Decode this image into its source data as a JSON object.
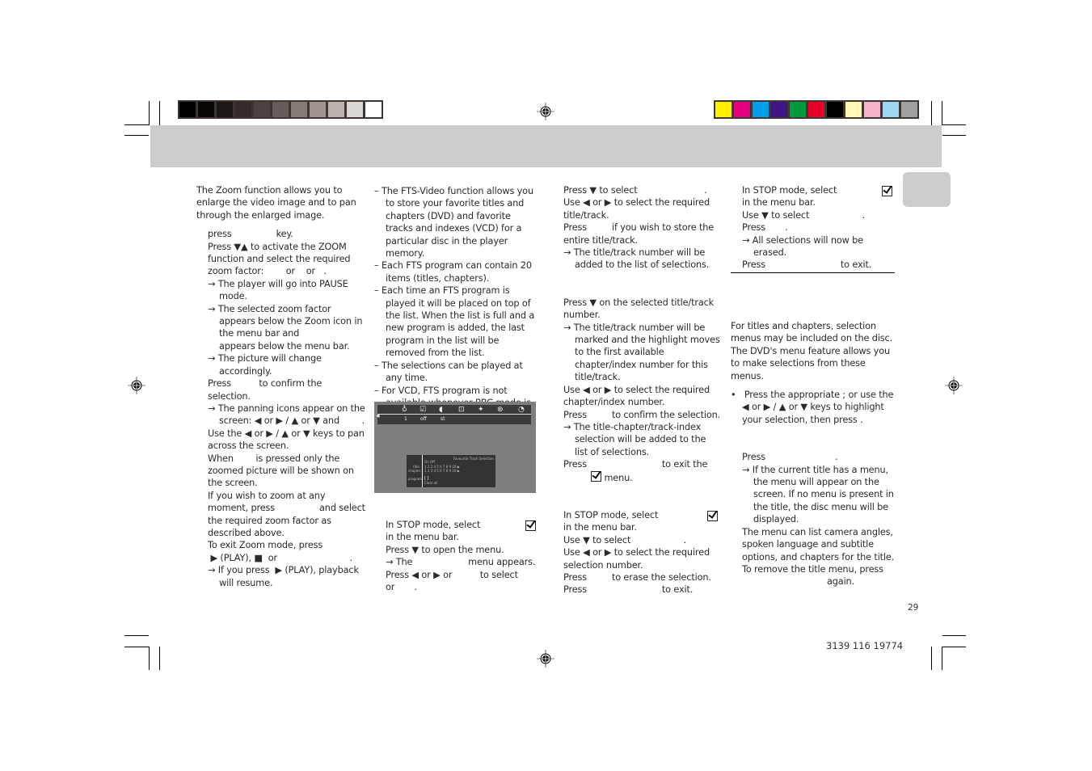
{
  "colorbars": {
    "grayscale": [
      "#000000",
      "#090606",
      "#1e1815",
      "#342a27",
      "#4b4340",
      "#655d59",
      "#857a76",
      "#a09590",
      "#bdb3ae",
      "#ddd7d3",
      "#ffffff"
    ],
    "process": [
      "#fff100",
      "#e4007f",
      "#00a0e9",
      "#3e1582",
      "#009a3e",
      "#e60026",
      "#000000",
      "#fff9b1",
      "#f7b3cb",
      "#9fd6f4",
      "#a0a0a0"
    ]
  },
  "col1": {
    "intro": "The Zoom function allows you to enlarge the video image and to pan through the enlarged image.",
    "lines": [
      {
        "type": "ind",
        "text": "press                key."
      },
      {
        "type": "ind",
        "text": "Press ▼▲ to activate the ZOOM function and select the required zoom factor:        or    or   ."
      },
      {
        "type": "arr",
        "text": "→ The player will go into PAUSE mode."
      },
      {
        "type": "arr",
        "text": "→ The selected zoom factor appears below the Zoom icon in the menu bar and"
      },
      {
        "type": "cont",
        "text": "appears below the menu bar."
      },
      {
        "type": "arr",
        "text": "→ The picture will change accordingly."
      },
      {
        "type": "ind",
        "text": "Press          to confirm the selection."
      },
      {
        "type": "arr",
        "text": "→ The panning icons appear on the screen: ◀ or ▶ / ▲ or ▼ and        ."
      },
      {
        "type": "ind",
        "text": "Use the ◀ or ▶ / ▲ or ▼ keys to pan across the screen."
      },
      {
        "type": "ind",
        "text": "When        is pressed only the zoomed picture will be shown on the screen."
      },
      {
        "type": "ind",
        "text": "If you wish to zoom at any moment, press                and select the required zoom factor as described above."
      },
      {
        "type": "ind",
        "text": "To exit Zoom mode, press"
      },
      {
        "type": "ind",
        "text": " ▶ (PLAY), ■  or                          ."
      },
      {
        "type": "arr",
        "text": "→ If you press  ▶ (PLAY), playback will resume."
      }
    ]
  },
  "col2": {
    "bullets": [
      "The FTS-Video function allows you to store your favorite titles and chapters (DVD) and favorite tracks and indexes (VCD) for a particular disc in the player memory.",
      "Each FTS program can contain 20 items (titles, chapters).",
      "Each time an FTS program is played it will be placed on top of the list. When the list is full and a new program is added, the last program in the list will be removed from the list.",
      "The selections can be played at any time.",
      "For VCD,  FTS program is not available whenever PBC mode is switched on."
    ],
    "screen": {
      "menu_values": [
        "1",
        "off",
        "st"
      ],
      "fts_title": "Favourite Track Selection",
      "on_off": "On   Off",
      "row_title_label": "title",
      "row_chapter_label": "chapter",
      "row_numbers": "1  2  3  4  5  6  7  8  9  10 ▶",
      "program_label": "program",
      "program_value": "[ ]",
      "clear_all": "Clear all"
    },
    "steps": [
      {
        "type": "plain",
        "text": "In STOP mode, select",
        "check": true
      },
      {
        "type": "plain",
        "text": "in the menu bar."
      },
      {
        "type": "plain",
        "text": "Press ▼ to open the menu."
      },
      {
        "type": "arrow",
        "text": "→ The                    menu appears."
      },
      {
        "type": "plain",
        "text": "Press ◀ or ▶ or          to select"
      },
      {
        "type": "plain",
        "text": "or       ."
      }
    ]
  },
  "col3": {
    "block1": [
      {
        "type": "plain",
        "text": "Press ▼ to select                        ."
      },
      {
        "type": "plain",
        "text": "Use ◀ or ▶ to select the required title/track."
      },
      {
        "type": "plain",
        "text": "Press         if you wish to store the entire title/track."
      },
      {
        "type": "arr",
        "text": "→ The title/track number will be added to the list of selections."
      }
    ],
    "block2": [
      {
        "type": "plain",
        "text": "Press ▼ on the selected title/track number."
      },
      {
        "type": "arr",
        "text": "→ The title/track number will be marked and the highlight moves to the first available chapter/index number for this title/track."
      },
      {
        "type": "plain",
        "text": "Use ◀ or ▶ to select the required chapter/index number."
      },
      {
        "type": "plain",
        "text": "Press         to confirm the selection."
      },
      {
        "type": "arr",
        "text": "→ The title-chapter/track-index selection will be added to the list of selections."
      },
      {
        "type": "plain",
        "text": "Press                           to exit the"
      },
      {
        "type": "menu",
        "text": "menu."
      }
    ],
    "block3": [
      {
        "type": "plain",
        "text": "In STOP mode, select",
        "check": true
      },
      {
        "type": "plain",
        "text": "in the menu bar."
      },
      {
        "type": "plain",
        "text": "Use ▼ to select                   ."
      },
      {
        "type": "plain",
        "text": "Use ◀ or ▶ to select the required selection number."
      },
      {
        "type": "plain",
        "text": "Press         to erase the selection."
      },
      {
        "type": "plain",
        "text": "Press                           to exit."
      }
    ]
  },
  "col4": {
    "block1": [
      {
        "type": "plain",
        "text": "In STOP mode, select",
        "check": true
      },
      {
        "type": "plain",
        "text": "in the menu bar."
      },
      {
        "type": "plain",
        "text": "Use ▼ to select                   ."
      },
      {
        "type": "plain",
        "text": "Press       ."
      },
      {
        "type": "arr",
        "text": "→ All selections will now be erased."
      },
      {
        "type": "plain",
        "text": "Press                           to exit."
      }
    ],
    "intro": "For titles and chapters, selection menus may be included on the disc. The DVD's menu feature allows you to make selections from these menus.",
    "bullet": "Press the appropriate                ; or use the ◀ or ▶ / ▲ or ▼ keys to highlight your selection, then press        .",
    "block2": [
      {
        "type": "plain",
        "text": "Press                         ."
      },
      {
        "type": "arr",
        "text": "→ If the current title has a menu, the menu will appear on the screen. If no menu is present in the title, the disc menu will be displayed."
      },
      {
        "type": "ind",
        "text": "The menu can list camera angles, spoken language and subtitle options, and chapters for the title."
      },
      {
        "type": "ind",
        "text": "To remove the title menu, press"
      },
      {
        "type": "ind2",
        "text": "again."
      }
    ]
  },
  "footer": {
    "page_number": "29",
    "part_number": "3139 116 19774"
  }
}
